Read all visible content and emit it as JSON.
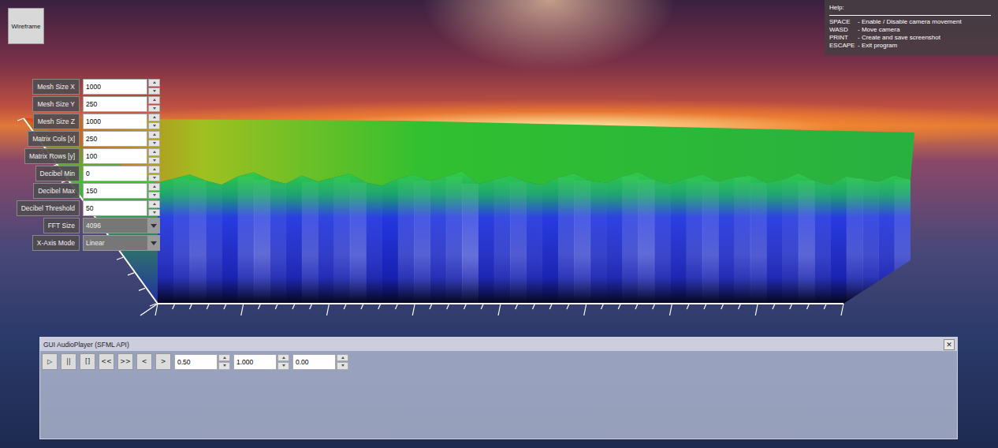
{
  "toolbar": {
    "wireframe_button": "Wireframe"
  },
  "help": {
    "title": "Help:",
    "items": [
      {
        "key": "SPACE",
        "description": "- Enable / Disable camera movement"
      },
      {
        "key": "WASD",
        "description": "- Move camera"
      },
      {
        "key": "PRINT",
        "description": "- Create and save screenshot"
      },
      {
        "key": "ESCAPE",
        "description": "- Exit program"
      }
    ]
  },
  "settings": [
    {
      "label": "Mesh Size X",
      "kind": "spinbox",
      "value": "1000"
    },
    {
      "label": "Mesh Size Y",
      "kind": "spinbox",
      "value": "250"
    },
    {
      "label": "Mesh Size Z",
      "kind": "spinbox",
      "value": "1000"
    },
    {
      "label": "Matrix Cols [x]",
      "kind": "spinbox",
      "value": "250"
    },
    {
      "label": "Matrix Rows [y]",
      "kind": "spinbox",
      "value": "100"
    },
    {
      "label": "Decibel Min",
      "kind": "spinbox",
      "value": "0"
    },
    {
      "label": "Decibel Max",
      "kind": "spinbox",
      "value": "150"
    },
    {
      "label": "Decibel Threshold",
      "kind": "spinbox",
      "value": "50"
    },
    {
      "label": "FFT Size",
      "kind": "dropdown",
      "value": "4096"
    },
    {
      "label": "X-Axis Mode",
      "kind": "dropdown",
      "value": "Linear"
    }
  ],
  "spectrogram": {
    "front_profile": [
      118,
      122,
      126,
      120,
      116,
      124,
      128,
      121,
      117,
      125,
      119,
      123,
      127,
      118,
      115,
      122,
      126,
      120,
      124,
      129,
      117,
      121,
      125,
      119,
      116,
      123,
      127,
      120,
      118,
      124,
      128,
      121,
      117,
      122,
      126,
      119,
      123,
      125,
      118,
      121,
      127,
      120,
      116,
      124,
      122,
      119,
      125,
      121
    ]
  },
  "player": {
    "title": "GUI AudioPlayer (SFML API)",
    "close": "✕",
    "buttons": [
      "▷",
      "||",
      "[]",
      "<<",
      ">>",
      "<",
      ">"
    ],
    "fields": [
      "0.50",
      "1.000",
      "0.00"
    ]
  }
}
